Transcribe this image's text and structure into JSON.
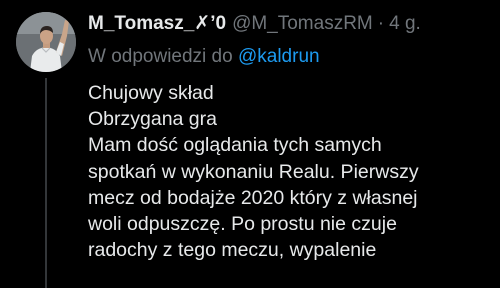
{
  "tweet": {
    "display_name": "M_Tomasz_✗ʼ0",
    "handle": "@M_TomaszRM",
    "separator": "·",
    "time": "4 g.",
    "reply_prefix": "W odpowiedzi do",
    "reply_mention": "@kaldrun",
    "lines": [
      "Chujowy skład",
      "Obrzygana gra",
      "Mam dość oglądania tych samych",
      "spotkań w wykonaniu Realu. Pierwszy",
      "mecz od bodajże 2020 który z własnej",
      "woli odpuszczę. Po prostu nie czuje",
      "radochy z tego meczu, wypalenie"
    ]
  },
  "colors": {
    "background": "#000000",
    "text": "#e7e9ea",
    "secondary": "#71767b",
    "link": "#1d9bf0"
  }
}
